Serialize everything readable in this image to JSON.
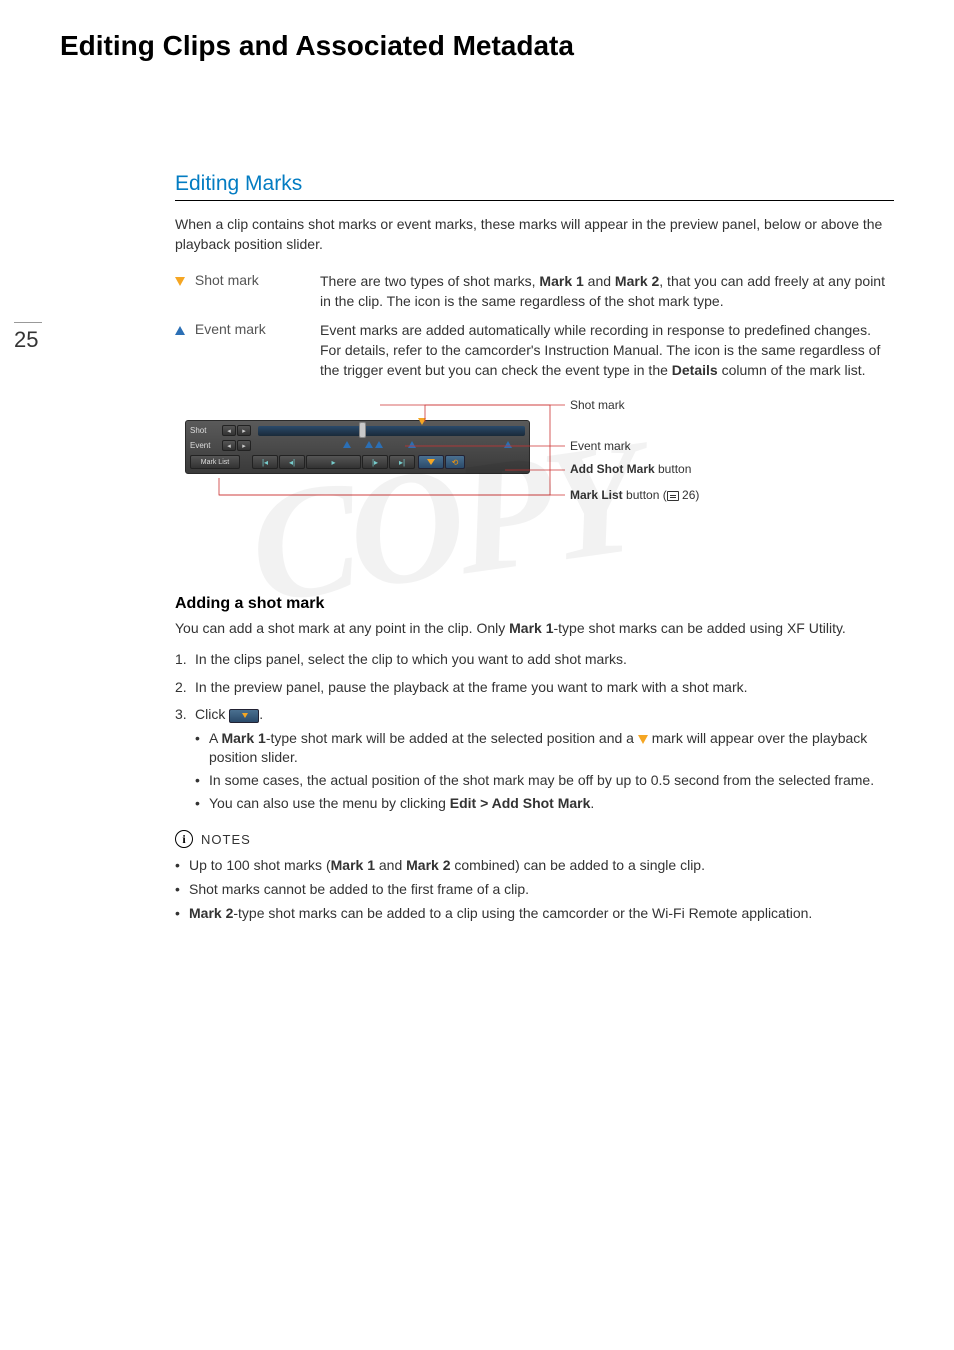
{
  "page_number": "25",
  "main_title": "Editing Clips and Associated Metadata",
  "section_title": "Editing Marks",
  "intro": "When a clip contains shot marks or event marks, these marks will appear in the preview panel, below or above the playback position slider.",
  "defs": {
    "shot": {
      "term": "Shot mark",
      "desc_pre": "There are two types of shot marks, ",
      "m1": "Mark 1",
      "and": " and ",
      "m2": "Mark 2",
      "desc_post": ", that you can add freely at any point in the clip. The icon is the same regardless of the shot mark type."
    },
    "event": {
      "term": "Event mark",
      "desc_pre": "Event marks are added automatically while recording in response to predefined changes. For details, refer to the camcorder's Instruction Manual. The icon is the same regardless of the trigger event but you can check the event type in the ",
      "details": "Details",
      "desc_post": " column of the mark list."
    }
  },
  "diagram": {
    "shot_label": "Shot",
    "event_label": "Event",
    "marklist_btn": "Mark List",
    "callouts": {
      "shot_mark": "Shot mark",
      "event_mark": "Event mark",
      "add_shot_pre": "Add Shot Mark",
      "add_shot_post": " button",
      "marklist_pre": "Mark List",
      "marklist_mid": " button (",
      "marklist_ref": " 26)"
    }
  },
  "subsection_title": "Adding a shot mark",
  "sub_intro_pre": "You can add a shot mark at any point in the clip. Only ",
  "sub_intro_bold": "Mark 1",
  "sub_intro_post": "-type shot marks can be added using XF Utility.",
  "steps": {
    "s1": "In the clips panel, select the clip to which you want to add shot marks.",
    "s2": "In the preview panel, pause the playback at the frame you want to mark with a shot mark.",
    "s3_pre": "Click ",
    "s3_post": ".",
    "b1_pre": "A ",
    "b1_bold": "Mark 1",
    "b1_mid": "-type shot mark will be added at the selected position and a ",
    "b1_post": " mark will appear over the playback position slider.",
    "b2": "In some cases, the actual position of the shot mark may be off by up to 0.5 second from the selected frame.",
    "b3_pre": "You can also use the menu by clicking ",
    "b3_bold": "Edit > Add Shot Mark",
    "b3_post": "."
  },
  "notes": {
    "label": "NOTES",
    "n1_pre": "Up to 100 shot marks (",
    "n1_m1": "Mark 1",
    "n1_and": " and ",
    "n1_m2": "Mark 2",
    "n1_post": " combined) can be added to a single clip.",
    "n2": "Shot marks cannot be added to the first frame of a clip.",
    "n3_bold": "Mark 2",
    "n3_post": "-type shot marks can be added to a clip using the camcorder or the Wi-Fi Remote application."
  },
  "watermark": "COPY"
}
